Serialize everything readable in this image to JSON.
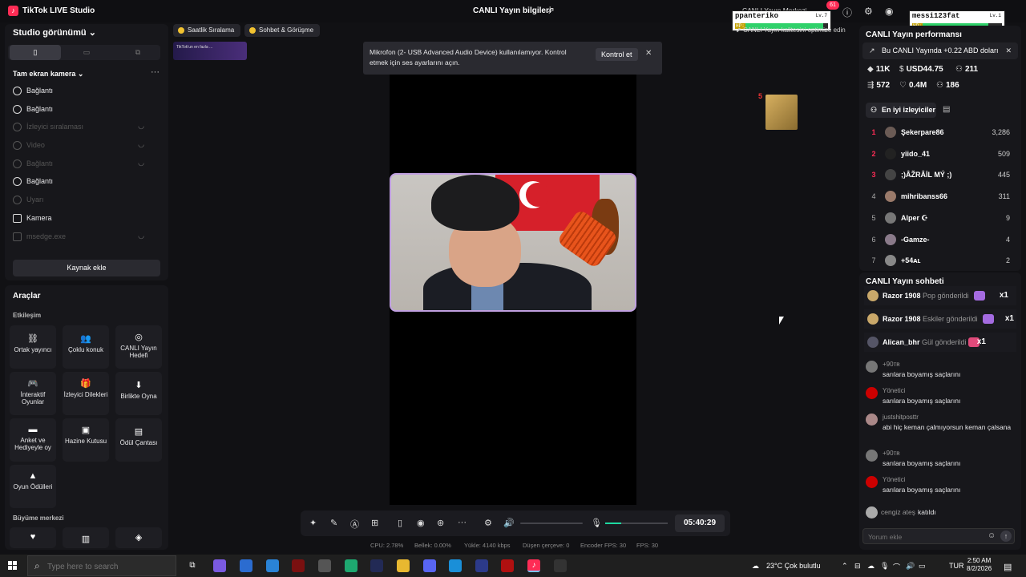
{
  "titlebar": {
    "app": "TikTok LIVE Studio",
    "center": "CANLI Yayın bilgileri"
  },
  "studio_view": {
    "title": "Studio görünümü"
  },
  "sources": {
    "header": "Tam ekran kamera",
    "items": [
      {
        "label": "Bağlantı",
        "icon": "globe-icon",
        "active": true
      },
      {
        "label": "Bağlantı",
        "icon": "globe-icon",
        "active": true
      },
      {
        "label": "İzleyici sıralaması",
        "icon": "globe-icon",
        "active": false
      },
      {
        "label": "Video",
        "icon": "play-icon",
        "active": false
      },
      {
        "label": "Bağlantı",
        "icon": "globe-icon",
        "active": false
      },
      {
        "label": "Bağlantı",
        "icon": "globe-icon",
        "active": true
      },
      {
        "label": "Uyarı",
        "icon": "bell-icon",
        "active": false
      },
      {
        "label": "Kamera",
        "icon": "camera-icon",
        "active": true
      },
      {
        "label": "msedge.exe",
        "icon": "window-icon",
        "active": false
      }
    ],
    "add_button": "Kaynak ekle"
  },
  "tools": {
    "title": "Araçlar",
    "section": "Etkileşim",
    "items": [
      {
        "label": "Ortak yayıncı"
      },
      {
        "label": "Çoklu konuk"
      },
      {
        "label": "CANLI Yayın Hedefi"
      },
      {
        "label": "İnteraktif Oyunlar"
      },
      {
        "label": "İzleyici Dilekleri"
      },
      {
        "label": "Birlikte Oyna"
      },
      {
        "label": "Anket ve Hediyeyle oy"
      },
      {
        "label": "Hazine Kutusu"
      },
      {
        "label": "Ödül Çantası"
      },
      {
        "label": "Oyun Ödülleri"
      }
    ],
    "growth_section": "Büyüme merkezi"
  },
  "chips": [
    "Saatlik Sıralama",
    "Sohbet & Görüşme"
  ],
  "banner_text": "TikTok'un en fazla ...",
  "notification": {
    "text": "Mikrofon (2- USB Advanced Audio Device) kullanılamıyor. Kontrol etmek için ses ayarlarını açın.",
    "button": "Kontrol et"
  },
  "controls": {
    "timer": "05:40:29",
    "mic_level": 0.25
  },
  "stats": {
    "cpu": "CPU: 2.78%",
    "memory": "Bellek: 0.00%",
    "upload": "Yükle: 4140 kbps",
    "dropped": "Düşen çerçeve: 0",
    "encoder_fps": "Encoder FPS: 30",
    "fps": "FPS: 30"
  },
  "overlays": {
    "hub": "CANLI Yayın Merkezi",
    "notif_count": "61",
    "hp1": {
      "name": "ppanteriko",
      "level": "Lv.7",
      "hp": 0.95
    },
    "hp2": {
      "name": "messi123fat",
      "level": "Lv.1",
      "hp": 0.85
    },
    "hp_label": "HP:",
    "caption": "CANLI Yayın kalitesini optimize edin"
  },
  "performance": {
    "title": "CANLI Yayın performansı",
    "gain": "Bu CANLI Yayında +0.22 ABD doları",
    "stats": [
      {
        "icon": "diamond-icon",
        "value": "11K"
      },
      {
        "icon": "dollar-icon",
        "value": "USD44.75"
      },
      {
        "icon": "viewers-icon",
        "value": "211"
      },
      {
        "icon": "share-icon",
        "value": "572"
      },
      {
        "icon": "heart-icon",
        "value": "0.4M"
      },
      {
        "icon": "users-icon",
        "value": "186"
      }
    ]
  },
  "top_viewers": {
    "tab": "En iyi izleyiciler",
    "rows": [
      {
        "rank": "1",
        "name": "Şekerpare86",
        "score": "3,286"
      },
      {
        "rank": "2",
        "name": "yiido_41",
        "score": "509"
      },
      {
        "rank": "3",
        "name": ";)ÂŽRÂİL MÝ ;)",
        "score": "445"
      },
      {
        "rank": "4",
        "name": "mihribanss66",
        "score": "311"
      },
      {
        "rank": "5",
        "name": "Alper ☪",
        "score": "9"
      },
      {
        "rank": "6",
        "name": "-Gamze-",
        "score": "4"
      },
      {
        "rank": "7",
        "name": "+54ᴀʟ",
        "score": "2"
      }
    ]
  },
  "chat": {
    "title": "CANLI Yayın sohbeti",
    "gifts": [
      {
        "user": "Razor 1908",
        "action": "Pop gönderildi",
        "count": "x1"
      },
      {
        "user": "Razor 1908",
        "action": "Eskiler gönderildi",
        "count": "x1"
      },
      {
        "user": "Alican_bhr",
        "action": "Gül gönderildi",
        "count": "x1"
      }
    ],
    "messages": [
      {
        "user": "+90ᴛʀ",
        "text": "sarılara boyamış saçlarını"
      },
      {
        "user": "Yönetici",
        "text": "sarılara boyamış saçlarını"
      },
      {
        "user": "justshitposttr",
        "text": "abi hiç keman çalmıyorsun keman çalsana"
      },
      {
        "user": "+90ᴛʀ",
        "text": "sarılara boyamış saçlarını"
      },
      {
        "user": "Yönetici",
        "text": "sarılara boyamış saçlarını"
      }
    ],
    "join": {
      "user": "cengiz ateş",
      "text": "katıldı"
    },
    "input_placeholder": "Yorum ekle"
  },
  "taskbar": {
    "search_placeholder": "Type here to search",
    "weather": "23°C  Çok bulutlu",
    "lang": "TUR",
    "time": "2:50 AM",
    "date": "8/2/2026"
  }
}
